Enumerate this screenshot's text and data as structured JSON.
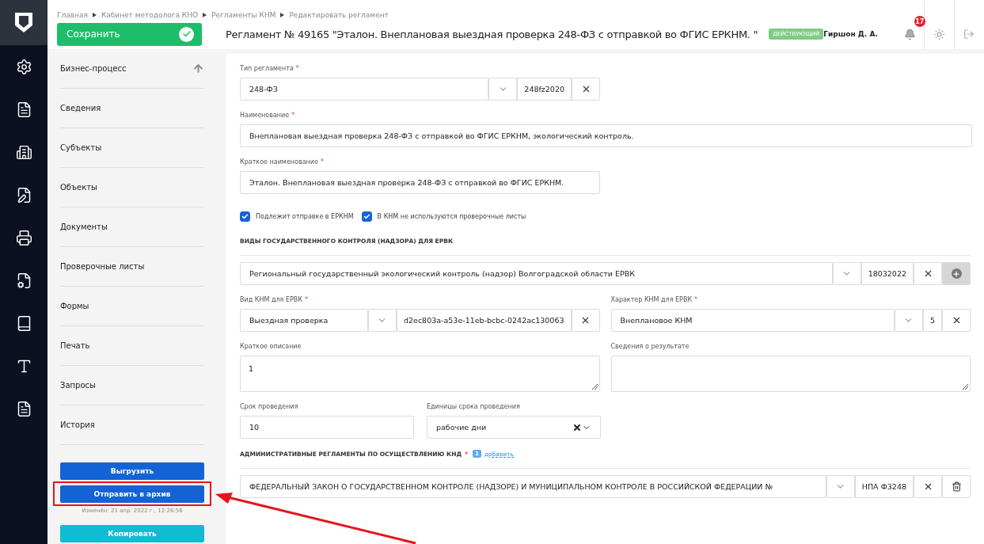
{
  "breadcrumbs": [
    "Главная",
    "Кабинет методолога КНО",
    "Регламенты КНМ",
    "Редактировать регламент"
  ],
  "save_button": "Сохранить",
  "title": "Регламент № 49165 \"Эталон. Внеплановая выездная проверка 248-ФЗ с отправкой во ФГИС ЕРКНМ. \"",
  "status_badge": "ДЕЙСТВУЮЩИЙ",
  "user": "Гиршон Д. А.",
  "notifications": "17",
  "sidebar": {
    "items": [
      {
        "label": "Бизнес-процесс",
        "selected": false
      },
      {
        "label": "Сведения",
        "selected": false
      },
      {
        "label": "Субъекты",
        "selected": false
      },
      {
        "label": "Объекты",
        "selected": false
      },
      {
        "label": "Документы",
        "selected": false
      },
      {
        "label": "Проверочные листы",
        "selected": false
      },
      {
        "label": "Формы",
        "selected": false
      },
      {
        "label": "Печать",
        "selected": false
      },
      {
        "label": "Запросы",
        "selected": false
      },
      {
        "label": "История",
        "selected": false
      }
    ],
    "export_button": "Выгрузить",
    "archive_button": "Отправить в архив",
    "modified": "Изменён: 21 апр. 2022 г., 12:26:56",
    "copy_button": "Копировать"
  },
  "form": {
    "reg_type": {
      "label": "Тип регламента",
      "required_mark": "*",
      "value": "248-ФЗ",
      "code": "248fz2020"
    },
    "name": {
      "label": "Наименование",
      "required_mark": "*",
      "value": "Внеплановая выездная проверка 248-ФЗ с отправкой во ФГИС ЕРКНМ, экологический контроль."
    },
    "short_name": {
      "label": "Краткое наименование",
      "required_mark": "*",
      "value": "Эталон. Внеплановая выездная проверка 248-ФЗ с отправкой во ФГИС ЕРКНМ."
    },
    "checkboxes": [
      {
        "label": "Подлежит отправке в ЕРКНМ",
        "checked": true
      },
      {
        "label": "В КНМ не используются проверочные листы",
        "checked": true
      }
    ],
    "control_section": "ВИДЫ ГОСУДАРСТВЕННОГО КОНТРОЛЯ (НАДЗОРА) ДЛЯ ЕРВК",
    "control_kind": {
      "value": "Региональный государственный экологический контроль (надзор) Волгоградской области ЕРВК",
      "code": "18032022"
    },
    "knm_kind": {
      "label": "Вид КНМ для ЕРВК",
      "required_mark": "*",
      "value": "Выездная проверка",
      "code": "d2ec803a-a53e-11eb-bcbc-0242ac130063"
    },
    "knm_character": {
      "label": "Характер КНМ для ЕРВК",
      "required_mark": "*",
      "value": "Внеплановое КНМ",
      "code": "5"
    },
    "description": {
      "label": "Краткое описание",
      "value": "1"
    },
    "result": {
      "label": "Сведения о результате"
    },
    "duration": {
      "label": "Срок проведения",
      "value": "10"
    },
    "duration_units": {
      "label": "Единицы срока проведения",
      "value": "рабочие дни"
    },
    "reg_section": {
      "label": "АДМИНИСТРАТИВНЫЕ РЕГЛАМЕНТЫ ПО ОСУЩЕСТВЛЕНИЮ КНД",
      "required_mark": "*",
      "count": "1",
      "link": "добавить"
    },
    "regulation": {
      "value": "ФЕДЕРАЛЬНЫЙ ЗАКОН О ГОСУДАРСТВЕННОМ КОНТРОЛЕ (НАДЗОРЕ) И МУНИЦИПАЛЬНОМ КОНТРОЛЕ В РОССИЙСКОЙ ФЕДЕРАЦИИ №",
      "code": "НПА Ф3248"
    }
  }
}
